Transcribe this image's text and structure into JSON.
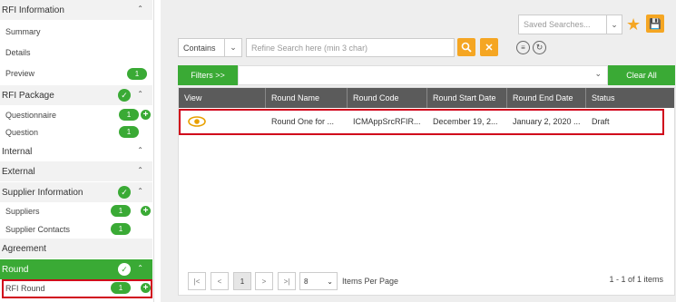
{
  "sidebar": {
    "rfi_information": "RFI Information",
    "summary": "Summary",
    "details": "Details",
    "preview": "Preview",
    "preview_count": "1",
    "rfi_package": "RFI Package",
    "questionnaire": "Questionnaire",
    "questionnaire_count": "1",
    "question": "Question",
    "question_count": "1",
    "internal": "Internal",
    "external": "External",
    "supplier_information": "Supplier Information",
    "suppliers": "Suppliers",
    "suppliers_count": "1",
    "supplier_contacts": "Supplier Contacts",
    "supplier_contacts_count": "1",
    "agreement": "Agreement",
    "round": "Round",
    "rfi_round": "RFI Round",
    "rfi_round_count": "1"
  },
  "toolbar": {
    "saved_searches_placeholder": "Saved Searches...",
    "contains": "Contains",
    "search_placeholder": "Refine Search here (min 3 char)",
    "filters": "Filters >>",
    "clear_all": "Clear All"
  },
  "table": {
    "headers": [
      "View",
      "Round Name",
      "Round Code",
      "Round Start Date",
      "Round End Date",
      "Status"
    ],
    "rows": [
      {
        "round_name": "Round One for ...",
        "round_code": "ICMAppSrcRFIR...",
        "start": "December 19, 2...",
        "end": "January 2, 2020 ...",
        "status": "Draft"
      }
    ]
  },
  "pager": {
    "page": "1",
    "per_page": "8",
    "items_per_page": "Items Per Page",
    "summary": "1 - 1 of 1 items"
  },
  "colors": {
    "green": "#3aaa35",
    "orange": "#f5a623",
    "header": "#5b5b5b",
    "highlight": "#d0021b"
  }
}
